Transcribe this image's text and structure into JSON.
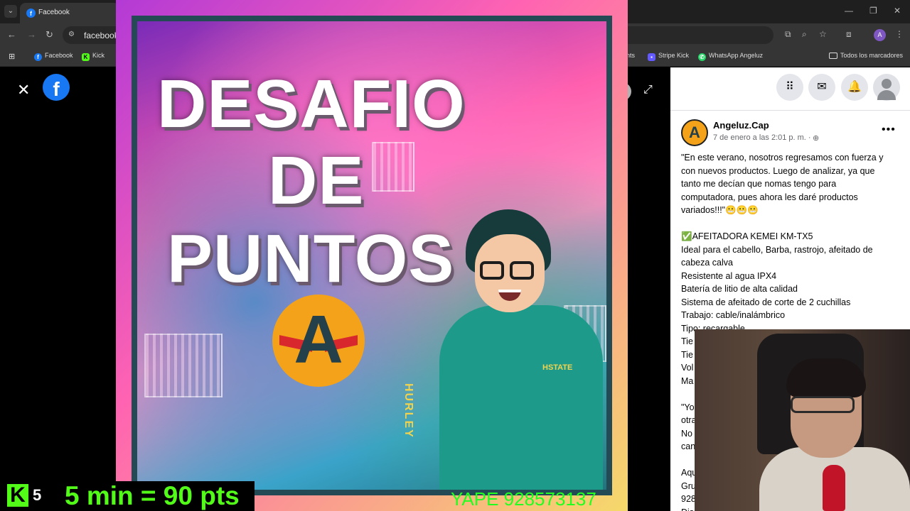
{
  "browser": {
    "tab_title": "Facebook",
    "url": "facebook.",
    "bookmarks": [
      {
        "label": "Facebook"
      },
      {
        "label": "Kick"
      },
      {
        "label": "ents"
      },
      {
        "label": "Stripe Kick"
      },
      {
        "label": "WhatsApp Angeluz"
      },
      {
        "label": "Todos los marcadores"
      }
    ],
    "profile_initial": "A"
  },
  "viewer": {
    "fb_logo": "f"
  },
  "poster": {
    "line1": "DESAFIO",
    "line2": "DE",
    "line3": "PUNTOS",
    "logo_letter": "A",
    "hoodie_text": "HSTATE",
    "sleeve_text": "HURLEY"
  },
  "overlay": {
    "yape": "YAPE 928573137",
    "kick_count": "5",
    "points": "5 min = 90 pts"
  },
  "post": {
    "author": "Angeluz.Cap",
    "date": "7 de enero a las 2:01 p. m. ·",
    "lines": [
      "\"En este verano, nosotros regresamos con fuerza y",
      "con nuevos productos. Luego de analizar, ya que",
      "tanto me decían que nomas tengo para",
      "computadora, pues ahora les daré productos",
      "variados!!!\"😬😬😬",
      "",
      "✅AFEITADORA KEMEI KM-TX5",
      "Ideal para el cabello, Barba, rastrojo, afeitado de",
      "cabeza calva",
      "Resistente al agua IPX4",
      "Batería de litio de alta calidad",
      "Sistema de afeitado de corte de 2 cuchillas",
      "Trabajo: cable/inalámbrico",
      "Tipo: recargable",
      "Tie",
      "Tie",
      "Vol",
      "Ma",
      "",
      "\"Yo",
      "otra",
      "No",
      "can",
      "",
      "Aqu",
      "Gru",
      "928",
      "Dis"
    ]
  },
  "icons": {
    "menu": "grid-menu-icon",
    "messenger": "messenger-icon",
    "notifications": "bell-icon",
    "account": "account-icon"
  }
}
